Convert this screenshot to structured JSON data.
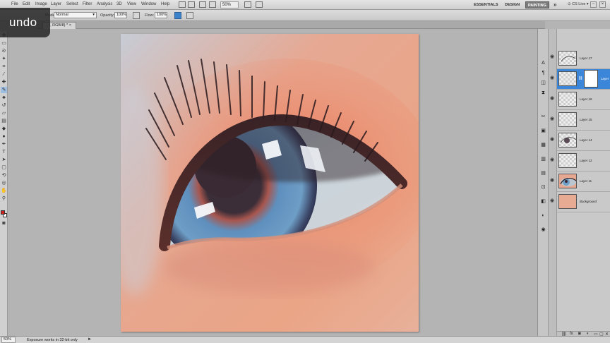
{
  "overlay": {
    "undo_text": "undo"
  },
  "menubar": {
    "items": [
      "File",
      "Edit",
      "Image",
      "Layer",
      "Select",
      "Filter",
      "Analysis",
      "3D",
      "View",
      "Window",
      "Help"
    ],
    "zoom": "50%",
    "workspaces": [
      "ESSENTIALS",
      "DESIGN",
      "PAINTING"
    ],
    "active_workspace": "PAINTING",
    "more": "»",
    "cs_live": "CS Live"
  },
  "options": {
    "mode_label": "Mode:",
    "mode_value": "Normal",
    "opacity_label": "Opacity:",
    "opacity_value": "100%",
    "flow_label": "Flow:",
    "flow_value": "100%"
  },
  "document": {
    "tab_title": "...f, RGB/8) *"
  },
  "status": {
    "zoom": "50%",
    "message": "Exposure works in 32-bit only",
    "arrow": "►"
  },
  "layers": [
    {
      "name": "Layer 17",
      "selected": false,
      "mask": false,
      "italic": false,
      "thumb": "sketch"
    },
    {
      "name": "Layer",
      "selected": true,
      "mask": true,
      "italic": false,
      "thumb": "blank"
    },
    {
      "name": "Layer 16",
      "selected": false,
      "mask": false,
      "italic": false,
      "thumb": "blank"
    },
    {
      "name": "Layer 15",
      "selected": false,
      "mask": false,
      "italic": false,
      "thumb": "blank"
    },
    {
      "name": "Layer 14",
      "selected": false,
      "mask": false,
      "italic": false,
      "thumb": "eye-sketch"
    },
    {
      "name": "Layer 12",
      "selected": false,
      "mask": false,
      "italic": false,
      "thumb": "blank"
    },
    {
      "name": "Layer 11",
      "selected": false,
      "mask": false,
      "italic": false,
      "thumb": "eye"
    },
    {
      "name": "Background",
      "selected": false,
      "mask": false,
      "italic": true,
      "thumb": "skin"
    }
  ],
  "colors": {
    "accent": "#3b86d8",
    "foreground": "#cc1f1f",
    "background": "#ffffff",
    "skin": "#e9a58a",
    "iris": "#6e9ec6"
  }
}
